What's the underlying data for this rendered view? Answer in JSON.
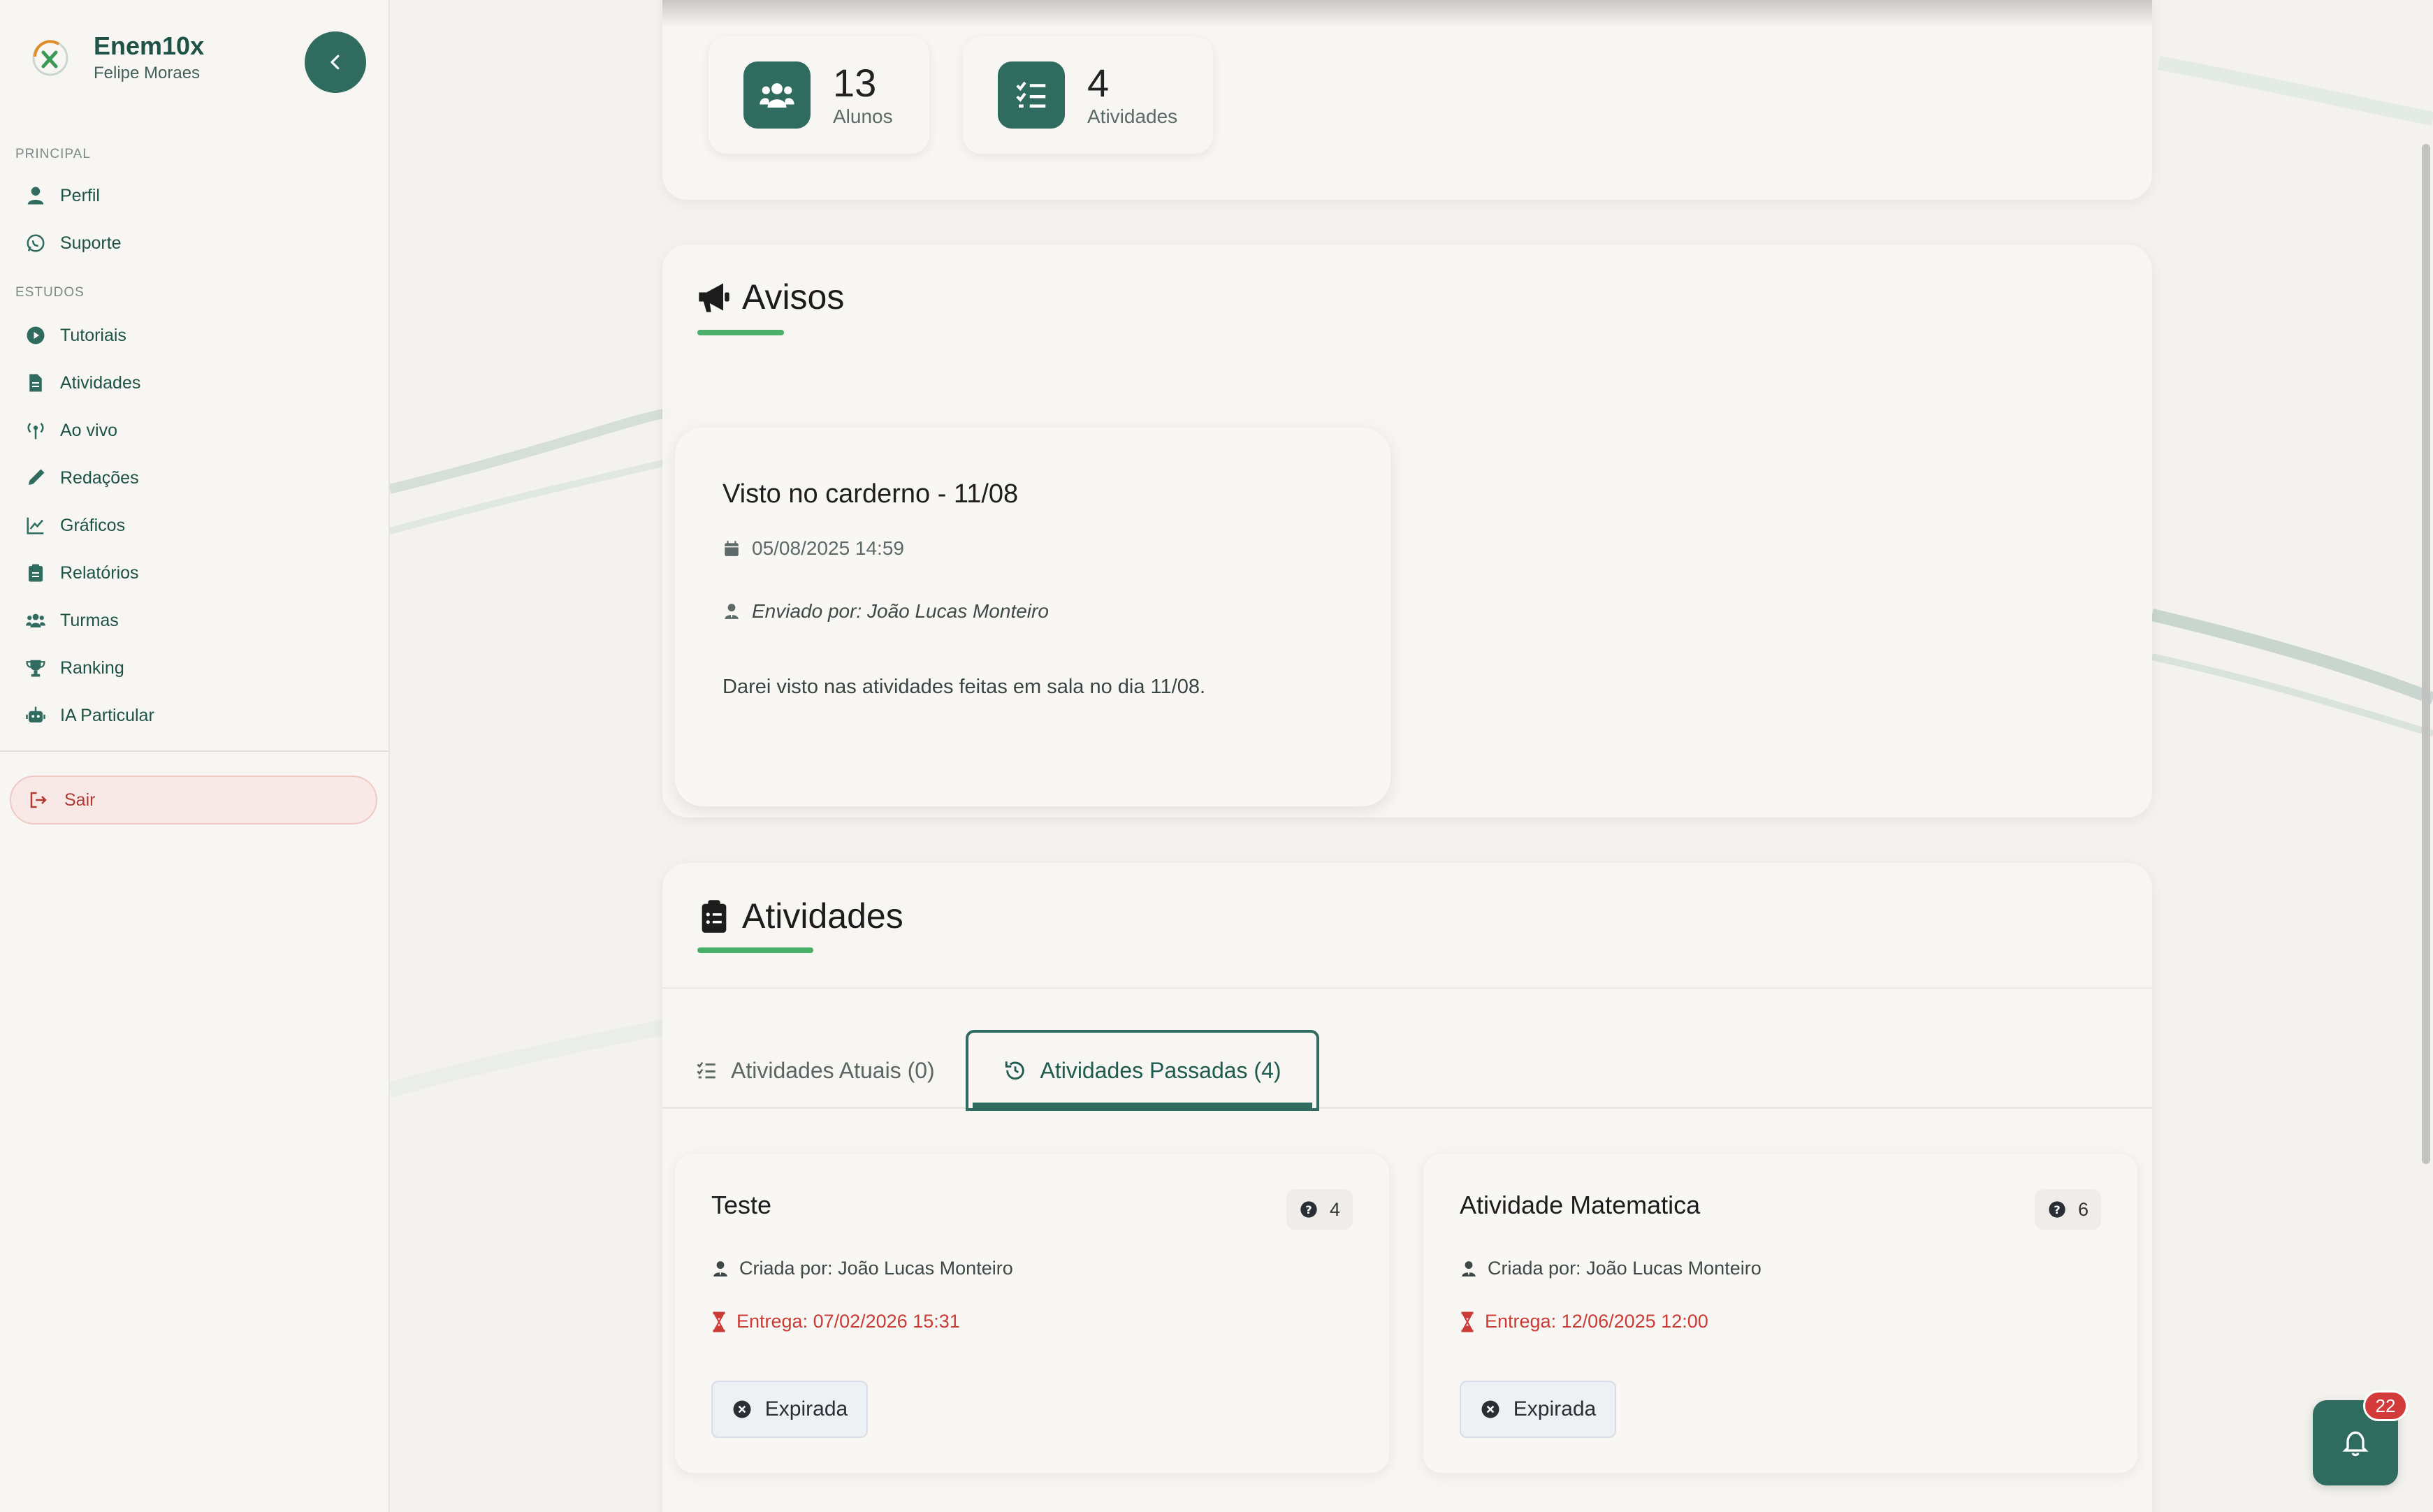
{
  "brand": {
    "name": "Enem10x",
    "user": "Felipe Moraes"
  },
  "sidebar": {
    "sections": {
      "principal": "PRINCIPAL",
      "estudos": "ESTUDOS"
    },
    "items": [
      {
        "label": "Perfil",
        "icon": "user-icon"
      },
      {
        "label": "Suporte",
        "icon": "whatsapp-icon"
      },
      {
        "label": "Tutoriais",
        "icon": "play-circle-icon"
      },
      {
        "label": "Atividades",
        "icon": "file-icon"
      },
      {
        "label": "Ao vivo",
        "icon": "broadcast-icon"
      },
      {
        "label": "Redações",
        "icon": "pen-icon"
      },
      {
        "label": "Gráficos",
        "icon": "line-chart-icon"
      },
      {
        "label": "Relatórios",
        "icon": "clipboard-icon"
      },
      {
        "label": "Turmas",
        "icon": "users-icon"
      },
      {
        "label": "Ranking",
        "icon": "trophy-icon"
      },
      {
        "label": "IA Particular",
        "icon": "robot-icon"
      }
    ],
    "logout_label": "Sair"
  },
  "stats": [
    {
      "value": "13",
      "label": "Alunos",
      "icon": "users-icon"
    },
    {
      "value": "4",
      "label": "Atividades",
      "icon": "tasks-icon"
    }
  ],
  "avisos": {
    "title": "Avisos",
    "items": [
      {
        "title": "Visto no carderno - 11/08",
        "date": "05/08/2025 14:59",
        "sender": "Enviado por: João Lucas Monteiro",
        "body": "Darei visto nas atividades feitas em sala no dia 11/08."
      }
    ]
  },
  "atividades": {
    "title": "Atividades",
    "tabs": [
      {
        "label": "Atividades Atuais (0)",
        "active": false
      },
      {
        "label": "Atividades Passadas (4)",
        "active": true
      }
    ],
    "cards": [
      {
        "title": "Teste",
        "questions": "4",
        "creator": "Criada por: João Lucas Monteiro",
        "due": "Entrega: 07/02/2026 15:31",
        "status": "Expirada"
      },
      {
        "title": "Atividade Matematica",
        "questions": "6",
        "creator": "Criada por: João Lucas Monteiro",
        "due": "Entrega: 12/06/2025 12:00",
        "status": "Expirada"
      }
    ]
  },
  "notifications": {
    "count": "22"
  },
  "colors": {
    "primary": "#2f6b5e",
    "accent": "#4caf6a",
    "danger": "#cc3b36"
  }
}
